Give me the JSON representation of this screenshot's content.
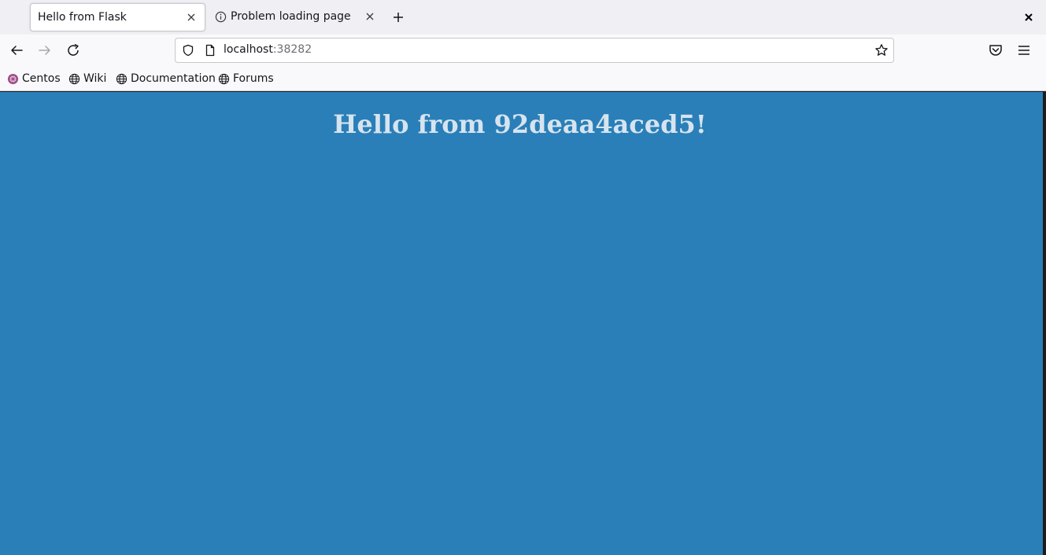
{
  "tabs": [
    {
      "label": "Hello from Flask",
      "active": true
    },
    {
      "label": "Problem loading page",
      "active": false
    }
  ],
  "urlbar": {
    "host": "localhost",
    "port": ":38282"
  },
  "bookmarks": [
    {
      "label": "Centos",
      "icon": "centos-icon"
    },
    {
      "label": "Wiki",
      "icon": "globe-icon"
    },
    {
      "label": "Documentation",
      "icon": "globe-icon"
    },
    {
      "label": "Forums",
      "icon": "globe-icon"
    }
  ],
  "page": {
    "heading": "Hello from 92deaa4aced5!"
  },
  "colors": {
    "content_bg": "#2a7fb8",
    "heading_text": "#d6e4ef",
    "centos_accent": "#a14f8c"
  }
}
